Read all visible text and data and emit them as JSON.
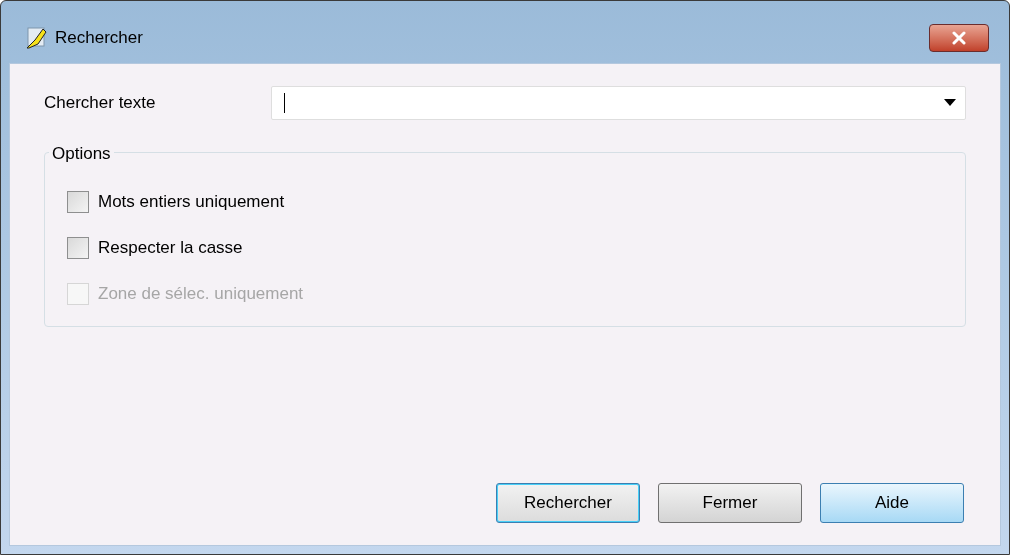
{
  "window": {
    "title": "Rechercher"
  },
  "search": {
    "label": "Chercher texte",
    "focused": true
  },
  "options": {
    "title": "Options",
    "items": [
      {
        "label": "Mots entiers uniquement",
        "checked": false,
        "disabled": false
      },
      {
        "label": "Respecter la casse",
        "checked": false,
        "disabled": false
      },
      {
        "label": "Zone de sélec. uniquement",
        "checked": false,
        "disabled": true
      }
    ]
  },
  "buttons": [
    {
      "label": "Rechercher",
      "default": true,
      "hovered": false
    },
    {
      "label": "Fermer",
      "default": false,
      "hovered": false
    },
    {
      "label": "Aide",
      "default": false,
      "hovered": true
    }
  ]
}
